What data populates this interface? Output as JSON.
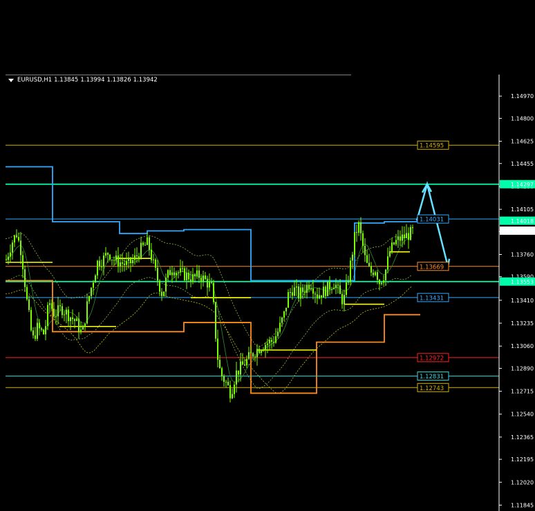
{
  "header": {
    "symbol": "EURUSD,H1",
    "open": "1.13845",
    "high": "1.13994",
    "low": "1.13826",
    "close": "1.13942"
  },
  "colors": {
    "background": "#000000",
    "candle": "#7CFC00",
    "axis": "#ffffff",
    "yellow": "#ffff00",
    "orange": "#ff8c1a",
    "blue": "#33aaff",
    "aqua": "#00ffaa",
    "red": "#ff2020",
    "arrow": "#66e0ff"
  },
  "chart_data": {
    "type": "candlestick",
    "ylim": [
      1.118,
      1.1505
    ],
    "yticks": [
      "1.14970",
      "1.14800",
      "1.14625",
      "1.14455",
      "1.14280",
      "1.14105",
      "1.13935",
      "1.13760",
      "1.13590",
      "1.13410",
      "1.13235",
      "1.13060",
      "1.12890",
      "1.12715",
      "1.12540",
      "1.12365",
      "1.12195",
      "1.12020",
      "1.11845"
    ],
    "price_labels": [
      {
        "label": "1.14297",
        "value": 1.14297,
        "bg": "#00ffaa",
        "fg": "#000000"
      },
      {
        "label": "1.14018",
        "value": 1.14018,
        "bg": "#00ffaa",
        "fg": "#000000"
      },
      {
        "label": "1.13942",
        "value": 1.13942,
        "bg": "#ffffff",
        "fg": "#000000"
      },
      {
        "label": "1.13553",
        "value": 1.13553,
        "bg": "#00ffaa",
        "fg": "#000000"
      }
    ],
    "levels": [
      {
        "label": "1.14595",
        "value": 1.14595,
        "color": "#d4b100"
      },
      {
        "label": "1.14297",
        "value": 1.14297,
        "color": "#00ffaa"
      },
      {
        "label": "1.14031",
        "value": 1.14031,
        "color": "#33aaff"
      },
      {
        "label": "1.13669",
        "value": 1.13669,
        "color": "#ff8c1a"
      },
      {
        "label": "1.13553",
        "value": 1.13553,
        "color": "#00ffaa"
      },
      {
        "label": "1.13431",
        "value": 1.13431,
        "color": "#33aaff"
      },
      {
        "label": "1.12972",
        "value": 1.12972,
        "color": "#ff2020"
      },
      {
        "label": "1.12831",
        "value": 1.12831,
        "color": "#33dddd"
      },
      {
        "label": "1.12743",
        "value": 1.12743,
        "color": "#d4b100"
      }
    ],
    "close_path": [
      [
        0,
        1.1372
      ],
      [
        8,
        1.1385
      ],
      [
        15,
        1.1392
      ],
      [
        22,
        1.1378
      ],
      [
        30,
        1.134
      ],
      [
        38,
        1.131
      ],
      [
        45,
        1.132
      ],
      [
        55,
        1.1315
      ],
      [
        62,
        1.134
      ],
      [
        70,
        1.133
      ],
      [
        80,
        1.1335
      ],
      [
        90,
        1.133
      ],
      [
        100,
        1.1325
      ],
      [
        110,
        1.1315
      ],
      [
        118,
        1.134
      ],
      [
        125,
        1.1355
      ],
      [
        132,
        1.137
      ],
      [
        140,
        1.1372
      ],
      [
        148,
        1.1378
      ],
      [
        155,
        1.1372
      ],
      [
        165,
        1.137
      ],
      [
        175,
        1.1368
      ],
      [
        185,
        1.1372
      ],
      [
        195,
        1.138
      ],
      [
        205,
        1.1385
      ],
      [
        212,
        1.137
      ],
      [
        220,
        1.1355
      ],
      [
        226,
        1.1345
      ],
      [
        232,
        1.1358
      ],
      [
        240,
        1.1366
      ],
      [
        250,
        1.1362
      ],
      [
        260,
        1.136
      ],
      [
        270,
        1.1358
      ],
      [
        280,
        1.136
      ],
      [
        290,
        1.1355
      ],
      [
        298,
        1.135
      ],
      [
        305,
        1.13
      ],
      [
        310,
        1.1285
      ],
      [
        318,
        1.1278
      ],
      [
        325,
        1.127
      ],
      [
        332,
        1.1285
      ],
      [
        340,
        1.129
      ],
      [
        348,
        1.1295
      ],
      [
        356,
        1.13
      ],
      [
        366,
        1.1305
      ],
      [
        376,
        1.1308
      ],
      [
        386,
        1.131
      ],
      [
        394,
        1.1318
      ],
      [
        402,
        1.133
      ],
      [
        408,
        1.1345
      ],
      [
        415,
        1.135
      ],
      [
        423,
        1.1345
      ],
      [
        432,
        1.135
      ],
      [
        440,
        1.1355
      ],
      [
        450,
        1.1345
      ],
      [
        460,
        1.1348
      ],
      [
        468,
        1.1352
      ],
      [
        475,
        1.1355
      ],
      [
        482,
        1.1345
      ],
      [
        488,
        1.134
      ],
      [
        494,
        1.1355
      ],
      [
        500,
        1.1375
      ],
      [
        505,
        1.1392
      ],
      [
        510,
        1.1398
      ],
      [
        515,
        1.1385
      ],
      [
        520,
        1.137
      ],
      [
        527,
        1.1362
      ],
      [
        534,
        1.1365
      ],
      [
        540,
        1.1355
      ],
      [
        548,
        1.1362
      ],
      [
        555,
        1.1378
      ],
      [
        562,
        1.1385
      ],
      [
        570,
        1.1388
      ],
      [
        578,
        1.139
      ],
      [
        585,
        1.1392
      ],
      [
        590,
        1.13942
      ]
    ],
    "arrow": [
      [
        595,
        1.14018
      ],
      [
        610,
        1.14297
      ],
      [
        640,
        1.13669
      ]
    ]
  }
}
